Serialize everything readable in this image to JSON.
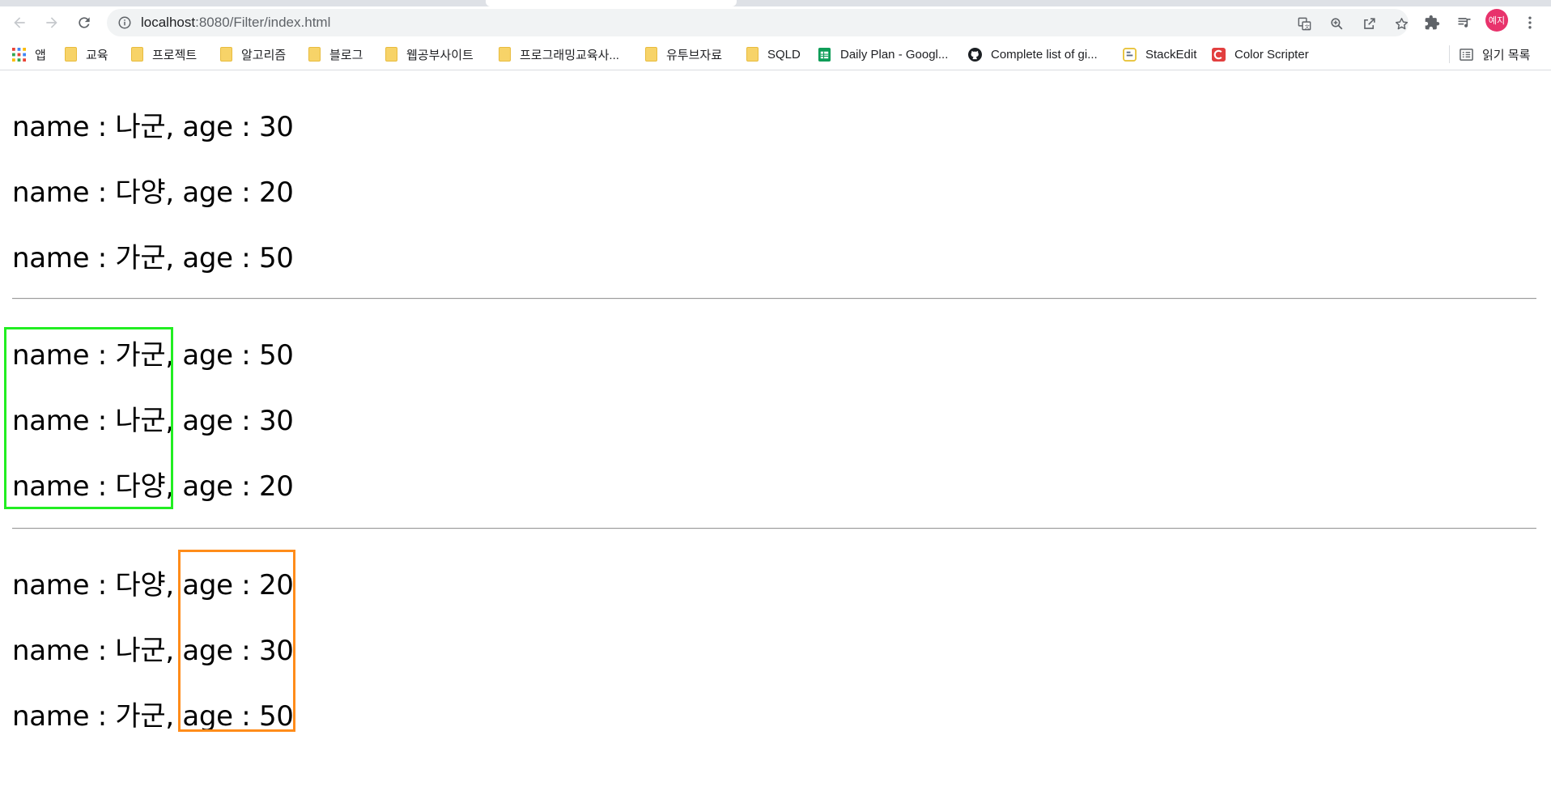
{
  "browser": {
    "url_host": "localhost",
    "url_rest": ":8080/Filter/index.html",
    "avatar_label": "예지",
    "reading_list_label": "읽기 목록"
  },
  "bookmarks": [
    {
      "label": "앱",
      "icon": "apps-grid-icon"
    },
    {
      "label": "교육",
      "icon": "folder-icon"
    },
    {
      "label": "프로젝트",
      "icon": "folder-icon"
    },
    {
      "label": "알고리즘",
      "icon": "folder-icon"
    },
    {
      "label": "블로그",
      "icon": "folder-icon"
    },
    {
      "label": "웹공부사이트",
      "icon": "folder-icon"
    },
    {
      "label": "프로그래밍교육사...",
      "icon": "folder-icon"
    },
    {
      "label": "유투브자료",
      "icon": "folder-icon"
    },
    {
      "label": "SQLD",
      "icon": "folder-icon"
    },
    {
      "label": "Daily Plan - Googl...",
      "icon": "google-sheets-icon"
    },
    {
      "label": "Complete list of gi...",
      "icon": "github-icon"
    },
    {
      "label": "StackEdit",
      "icon": "stackedit-icon"
    },
    {
      "label": "Color Scripter",
      "icon": "color-scripter-icon"
    }
  ],
  "lists": [
    {
      "items": [
        {
          "text": "name : 나군, age : 30"
        },
        {
          "text": "name : 다양, age : 20"
        },
        {
          "text": "name : 가군, age : 50"
        }
      ]
    },
    {
      "items": [
        {
          "text": "name : 가군, age : 50"
        },
        {
          "text": "name : 나군, age : 30"
        },
        {
          "text": "name : 다양, age : 20"
        }
      ]
    },
    {
      "items": [
        {
          "text": "name : 다양, age : 20"
        },
        {
          "text": "name : 나군, age : 30"
        },
        {
          "text": "name : 가군, age : 50"
        }
      ]
    }
  ],
  "highlight_colors": {
    "name_sort_box": "#22ee22",
    "age_sort_box": "#ff8c1a"
  }
}
